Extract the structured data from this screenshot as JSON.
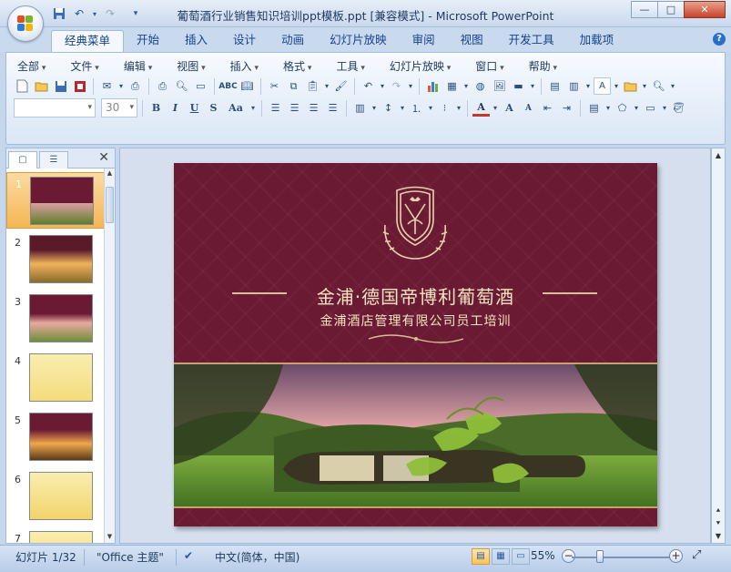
{
  "window": {
    "title": "葡萄酒行业销售知识培训ppt模板.ppt [兼容模式] - Microsoft PowerPoint",
    "minimize": "—",
    "maximize": "□",
    "close": "✕"
  },
  "ribbon_tabs": [
    "经典菜单",
    "开始",
    "插入",
    "设计",
    "动画",
    "幻灯片放映",
    "审阅",
    "视图",
    "开发工具",
    "加载项"
  ],
  "active_tab": "经典菜单",
  "classic_menus": [
    "全部",
    "文件",
    "编辑",
    "视图",
    "插入",
    "格式",
    "工具",
    "幻灯片放映",
    "窗口",
    "帮助"
  ],
  "font_combo": {
    "name": "",
    "size": "30"
  },
  "format_buttons": {
    "bold": "B",
    "italic": "I",
    "underline": "U",
    "strike": "S",
    "case": "Aa"
  },
  "pane": {
    "close": "✕"
  },
  "thumbnails": [
    {
      "num": "1",
      "style": "title",
      "selected": true
    },
    {
      "num": "2",
      "style": "sunset",
      "selected": false
    },
    {
      "num": "3",
      "style": "field",
      "selected": false
    },
    {
      "num": "4",
      "style": "yellow",
      "selected": false
    },
    {
      "num": "5",
      "style": "sunset2",
      "selected": false
    },
    {
      "num": "6",
      "style": "yellow2",
      "selected": false
    },
    {
      "num": "7",
      "style": "yellow3",
      "selected": false
    }
  ],
  "slide": {
    "title": "金浦·德国帝博利葡萄酒",
    "subtitle": "金浦酒店管理有限公司员工培训"
  },
  "status": {
    "slide_label": "幻灯片 1/32",
    "theme": "\"Office 主题\"",
    "language": "中文(简体，中国)",
    "zoom": "55%"
  },
  "colors": {
    "slide_bg": "#6b1a33",
    "gold": "#f4e4c2"
  }
}
